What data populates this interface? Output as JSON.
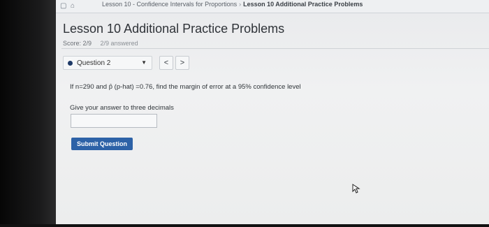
{
  "breadcrumb": {
    "items": [
      "Lesson 10 - Confidence Intervals for Proportions",
      "Lesson 10 Additional Practice Problems"
    ],
    "separator": "›"
  },
  "page": {
    "title": "Lesson 10 Additional Practice Problems",
    "score": "Score: 2/9",
    "answered": "2/9 answered"
  },
  "question_nav": {
    "selected": "Question 2",
    "prev_label": "<",
    "next_label": ">"
  },
  "question": {
    "text_before": "If n=290 and ",
    "p_hat_symbol": "p̂",
    "text_after": " (p-hat) =0.76, find the margin of error at a 95% confidence level",
    "instruction": "Give your answer to three decimals",
    "answer_value": ""
  },
  "actions": {
    "submit_label": "Submit Question"
  },
  "colors": {
    "accent": "#2d62a7",
    "status_dot": "#1f3a67"
  }
}
